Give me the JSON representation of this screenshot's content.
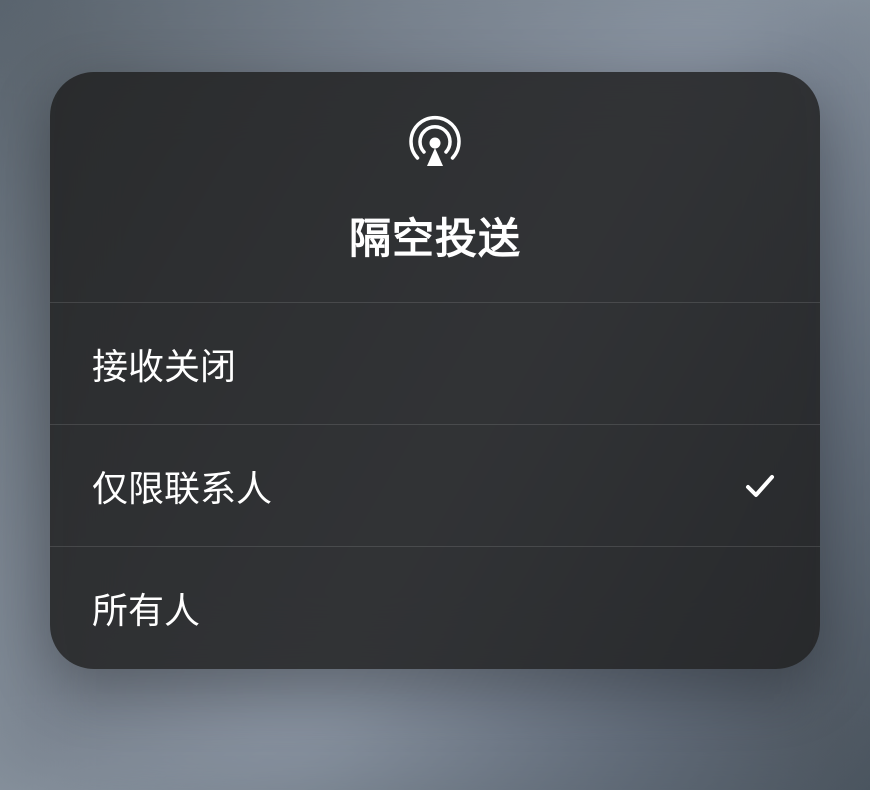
{
  "modal": {
    "title": "隔空投送",
    "icon": "airdrop-icon",
    "options": [
      {
        "label": "接收关闭",
        "selected": false
      },
      {
        "label": "仅限联系人",
        "selected": true
      },
      {
        "label": "所有人",
        "selected": false
      }
    ]
  }
}
